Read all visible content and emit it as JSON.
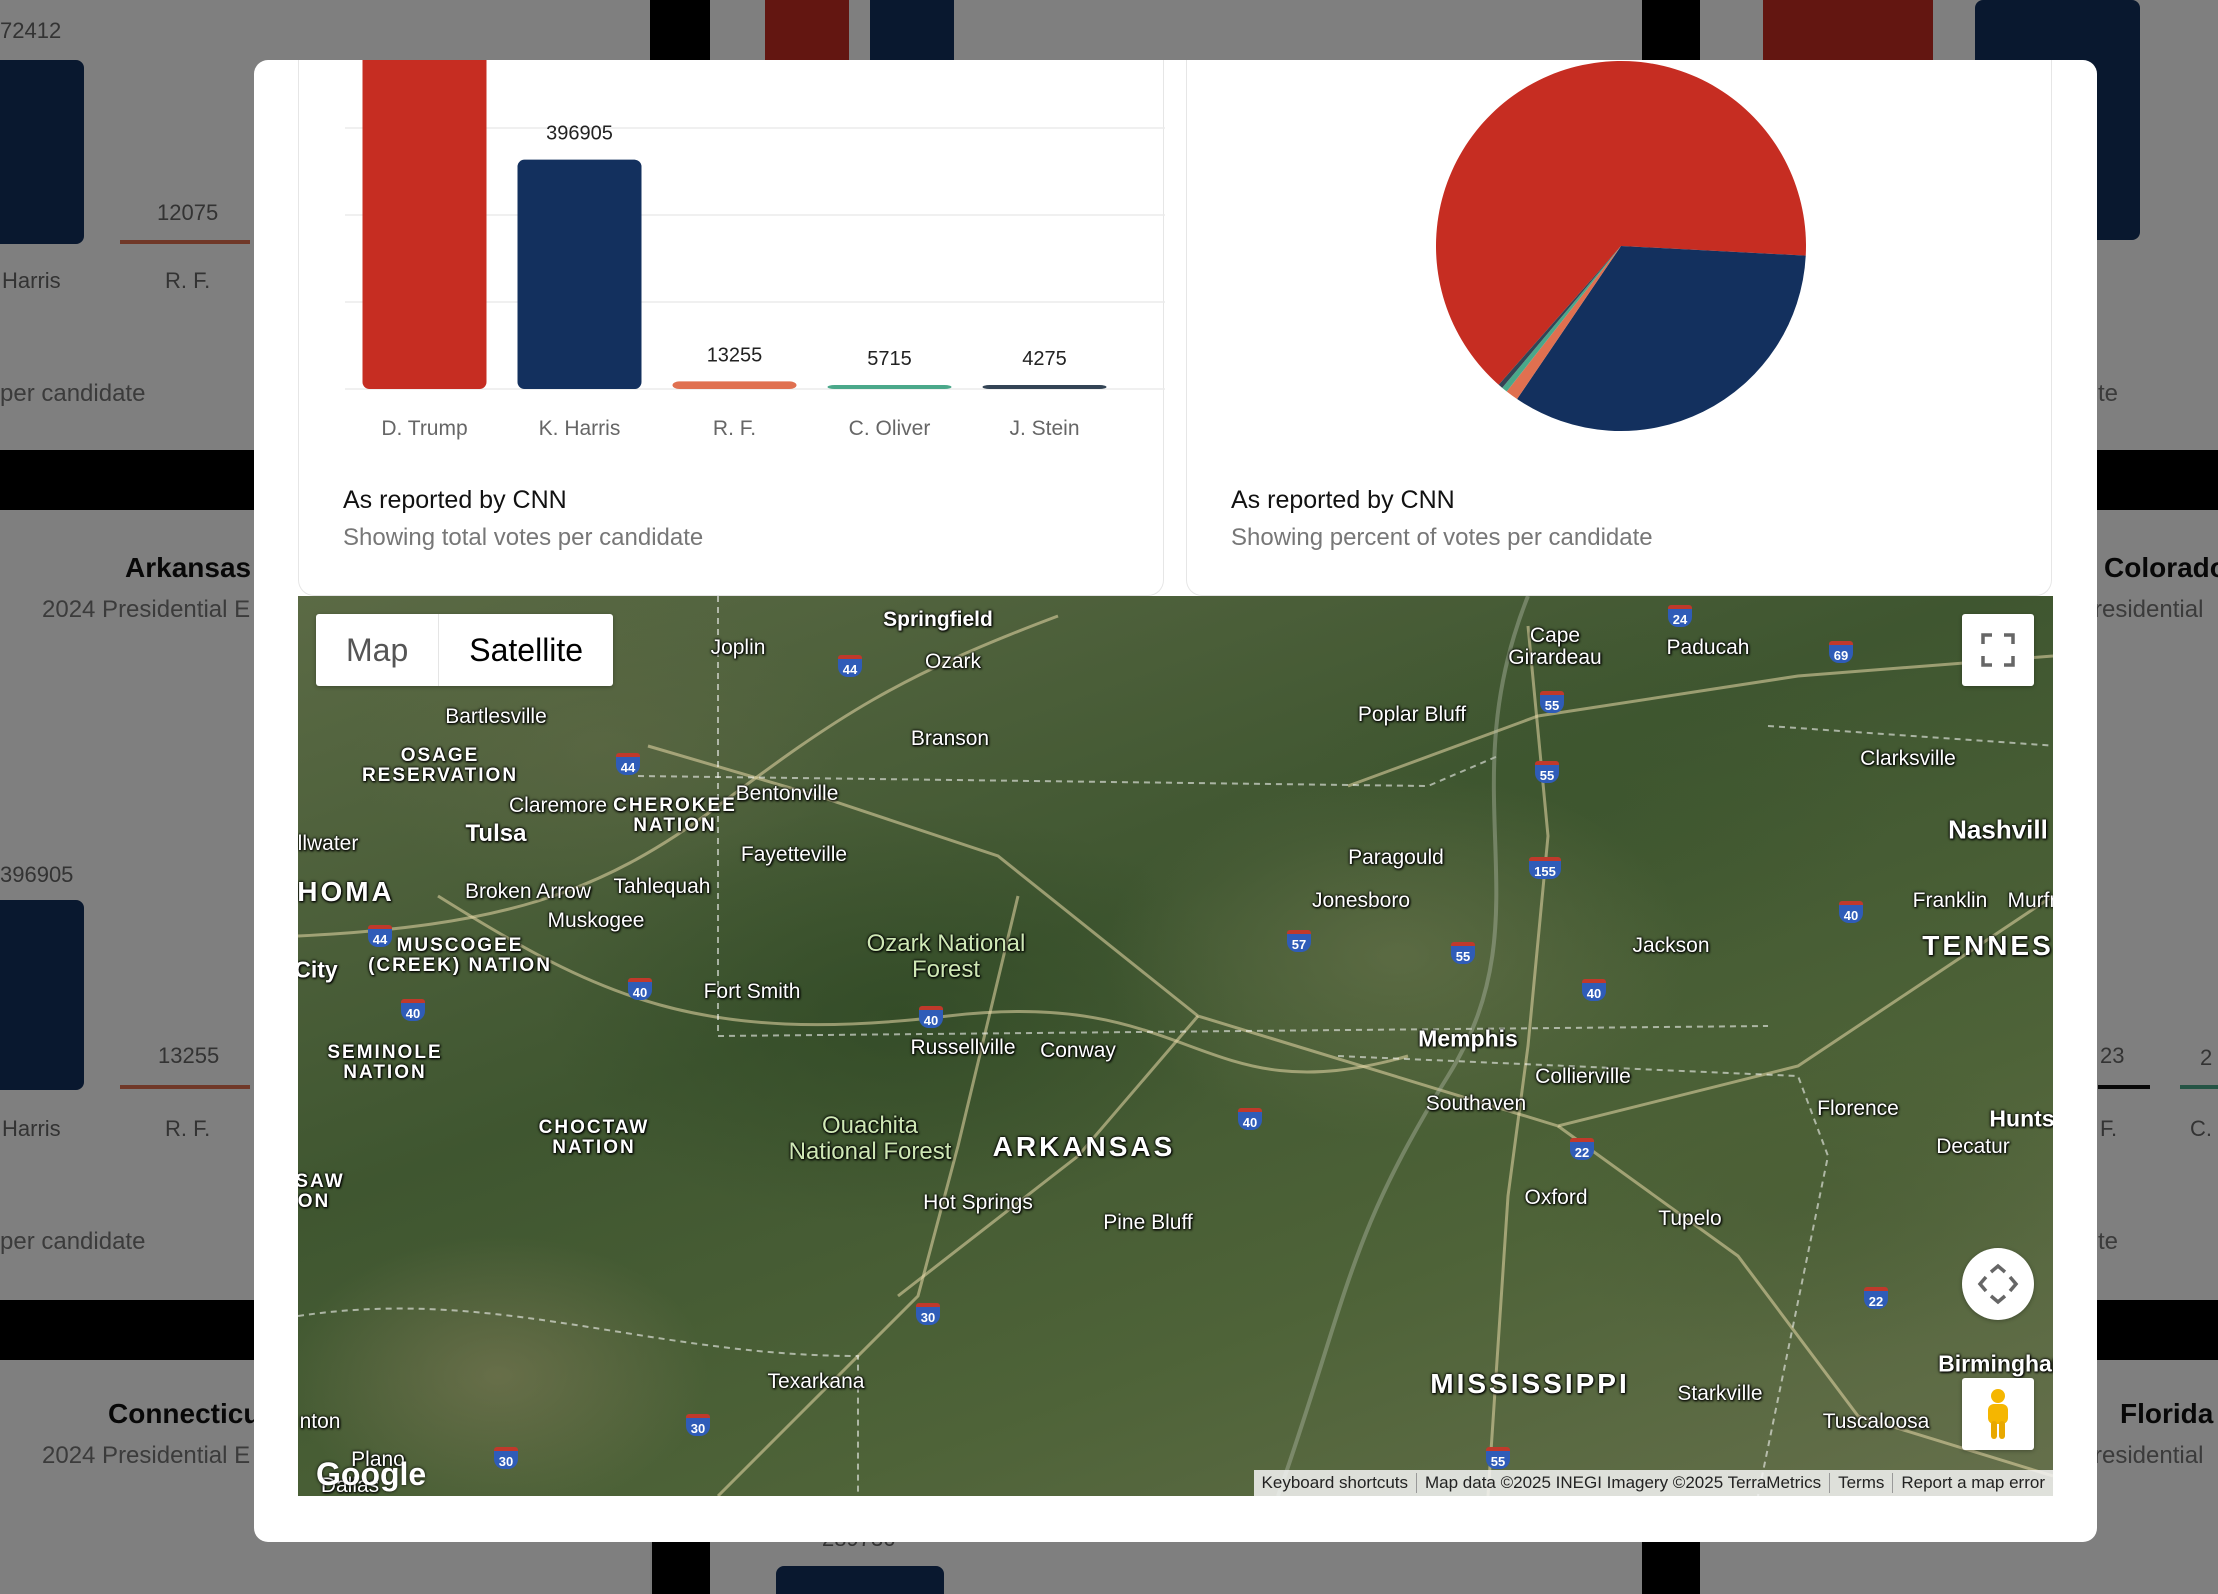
{
  "background": {
    "values": [
      "72412",
      "12075",
      "396905",
      "13255",
      "23",
      "2"
    ],
    "candidate_short": [
      "Harris",
      "R. F.",
      "Harris",
      "R. F.",
      "F.",
      "C."
    ],
    "notes": [
      "per candidate",
      "per candidate",
      "te",
      "te"
    ],
    "states": [
      "Arkansas",
      "Colorado",
      "Connecticu",
      "Florida"
    ],
    "subtitles": [
      "2024 Presidential E",
      "residential",
      "2024 Presidential E",
      "residential"
    ],
    "bottom_value": "289736"
  },
  "bar_chart": {
    "source": "As reported by CNN",
    "note": "Showing total votes per candidate"
  },
  "pie_chart": {
    "source": "As reported by CNN",
    "note": "Showing percent of votes per candidate"
  },
  "chart_data": [
    {
      "type": "bar",
      "categories": [
        "D. Trump",
        "K. Harris",
        "R. F.",
        "C. Oliver",
        "J. Stein"
      ],
      "values": [
        760647,
        396905,
        13255,
        5715,
        4275
      ],
      "data_labels": [
        "",
        "396905",
        "13255",
        "5715",
        "4275"
      ],
      "colors": [
        "#c62d22",
        "#13305e",
        "#e07050",
        "#4aa88a",
        "#334455"
      ],
      "grid": true
    },
    {
      "type": "pie",
      "categories": [
        "D. Trump",
        "K. Harris",
        "R. F.",
        "C. Oliver",
        "J. Stein"
      ],
      "values": [
        64.2,
        33.6,
        1.1,
        0.5,
        0.4
      ],
      "colors": [
        "#c62d22",
        "#13305e",
        "#e07050",
        "#4aa88a",
        "#334455"
      ]
    }
  ],
  "map": {
    "type_options": [
      "Map",
      "Satellite"
    ],
    "selected_type": "Satellite",
    "fullscreen_icon": "fullscreen-icon",
    "camera_icon": "camera-control-icon",
    "pegman_icon": "pegman-icon",
    "logo": "Google",
    "attribution": [
      "Keyboard shortcuts",
      "Map data ©2025 INEGI Imagery ©2025 TerraMetrics",
      "Terms",
      "Report a map error"
    ],
    "places": {
      "springfield": "Springfield",
      "joplin": "Joplin",
      "ozark": "Ozark",
      "cape": "Cape",
      "girardeau": "Girardeau",
      "paducah": "Paducah",
      "bartlesville": "Bartlesville",
      "osage": "OSAGE",
      "reservation": "RESERVATION",
      "branson": "Branson",
      "poplar_bluff": "Poplar Bluff",
      "clarksville": "Clarksville",
      "claremore": "Claremore",
      "cherokee": "CHEROKEE",
      "nation": "NATION",
      "bentonville": "Bentonville",
      "tulsa": "Tulsa",
      "stillwater": "llwater",
      "fayetteville": "Fayetteville",
      "nashville": "Nashvill",
      "paragould": "Paragould",
      "oklahoma": "HOMA",
      "broken_arrow": "Broken Arrow",
      "tahlequah": "Tahlequah",
      "jonesboro": "Jonesboro",
      "franklin": "Franklin",
      "murfreesboro": "Murfr",
      "muskogee": "Muskogee",
      "ozark_forest_1": "Ozark National",
      "ozark_forest_2": "Forest",
      "muscogee_1": "MUSCOGEE",
      "muscogee_2": "(CREEK) NATION",
      "jackson": "Jackson",
      "tennessee": "TENNES",
      "city": "City",
      "fort_smith": "Fort Smith",
      "russellville": "Russellville",
      "conway": "Conway",
      "memphis": "Memphis",
      "seminole_1": "SEMINOLE",
      "seminole_2": "NATION",
      "collierville": "Collierville",
      "southaven": "Southaven",
      "florence": "Florence",
      "huntsville": "Hunts",
      "choctaw_1": "CHOCTAW",
      "choctaw_2": "NATION",
      "ouachita_1": "Ouachita",
      "ouachita_2": "National Forest",
      "arkansas": "ARKANSAS",
      "decatur": "Decatur",
      "chickasaw_1": "SAW",
      "chickasaw_2": "ON",
      "oxford": "Oxford",
      "hot_springs": "Hot Springs",
      "tupelo": "Tupelo",
      "pine_bluff": "Pine Bluff",
      "birmingham": "Birminghan",
      "mississippi": "MISSISSIPPI",
      "starkville": "Starkville",
      "texarkana": "Texarkana",
      "tuscaloosa": "Tuscaloosa",
      "denton": "nton",
      "plano": "Plano",
      "dallas": "Dallas"
    },
    "shields": [
      "44",
      "44",
      "44",
      "44",
      "40",
      "40",
      "40",
      "40",
      "40",
      "40",
      "24",
      "69",
      "55",
      "55",
      "155",
      "57",
      "55",
      "22",
      "22",
      "30",
      "30",
      "30",
      "55"
    ]
  }
}
